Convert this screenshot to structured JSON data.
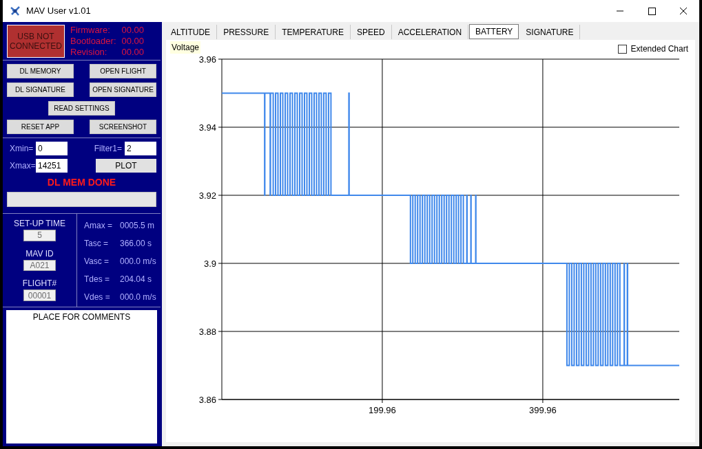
{
  "window": {
    "title": "MAV User v1.01"
  },
  "device": {
    "status": "USB NOT CONNECTED",
    "info": [
      {
        "label": "Firmware:",
        "value": "00.00"
      },
      {
        "label": "Bootloader:",
        "value": "00.00"
      },
      {
        "label": "Revision:",
        "value": "00.00"
      }
    ]
  },
  "button_rows": [
    [
      {
        "label": "DL MEMORY"
      },
      {
        "label": "OPEN FLIGHT"
      }
    ],
    [
      {
        "label": "DL SIGNATURE"
      },
      {
        "label": "OPEN SIGNATURE"
      }
    ],
    [
      {
        "label": "READ SETTINGS"
      }
    ],
    [
      {
        "label": "RESET APP"
      },
      {
        "label": "SCREENSHOT"
      }
    ]
  ],
  "plot_controls": {
    "xmin_label": "Xmin=",
    "xmin": "0",
    "filter_label": "Filter1=",
    "filter": "2",
    "xmax_label": "Xmax=",
    "xmax": "14251",
    "plot_button": "PLOT",
    "message": "DL MEM DONE",
    "progress": {
      "level": 0
    }
  },
  "setup": [
    {
      "label": "SET-UP TIME",
      "value": "5"
    },
    {
      "label": "MAV ID",
      "value": "A021"
    },
    {
      "label": "FLIGHT#",
      "value": "00001"
    }
  ],
  "results": [
    {
      "label": "Amax =",
      "value": "0005.5 m"
    },
    {
      "label": "Tasc =",
      "value": "366.00 s"
    },
    {
      "label": "Vasc =",
      "value": "000.0 m/s"
    },
    {
      "label": "Tdes =",
      "value": "204.04 s"
    },
    {
      "label": "Vdes =",
      "value": "000.0 m/s"
    }
  ],
  "comments": {
    "title": "PLACE FOR COMMENTS"
  },
  "tabs": [
    {
      "label": "ALTITUDE",
      "selected": false
    },
    {
      "label": "PRESSURE",
      "selected": false
    },
    {
      "label": "TEMPERATURE",
      "selected": false
    },
    {
      "label": "SPEED",
      "selected": false
    },
    {
      "label": "ACCELERATION",
      "selected": false
    },
    {
      "label": "BATTERY",
      "selected": true
    },
    {
      "label": "SIGNATURE",
      "selected": false
    }
  ],
  "extended_chart": {
    "label": "Extended Chart",
    "checked": false
  },
  "chart": {
    "chart_data": {
      "type": "line",
      "title": "Voltage",
      "grid": true,
      "xlim": [
        0,
        570
      ],
      "ylim": [
        3.86,
        3.96
      ],
      "xticks": [
        199.96,
        399.96
      ],
      "yticks": [
        3.86,
        3.88,
        3.9,
        3.92,
        3.94,
        3.96
      ],
      "x": [
        0,
        53,
        53.3,
        53.6,
        60,
        60.3,
        60.6,
        63,
        64,
        67,
        70,
        73,
        76,
        79,
        82,
        85,
        88,
        91,
        94,
        97,
        100,
        103,
        106,
        109,
        112,
        115,
        118,
        121,
        124,
        127,
        130,
        133,
        136,
        158,
        158.3,
        158.6,
        234,
        235,
        238,
        241,
        244,
        247,
        250,
        253,
        256,
        259,
        262,
        265,
        268,
        271,
        274,
        277,
        280,
        283,
        286,
        289,
        292,
        295,
        298,
        301,
        305,
        305.3,
        305.6,
        310,
        310.3,
        310.6,
        316,
        316.3,
        316.6,
        429,
        430,
        433,
        436,
        439,
        442,
        445,
        448,
        451,
        454,
        457,
        460,
        463,
        466,
        469,
        472,
        475,
        478,
        481,
        484,
        487,
        490,
        493,
        496,
        501,
        501.3,
        501.6,
        505,
        505.3,
        505.6,
        570
      ],
      "series": [
        {
          "color": "#3f88eb",
          "values": [
            3.95,
            3.95,
            3.92,
            3.95,
            3.95,
            3.92,
            3.95,
            3.95,
            3.92,
            3.95,
            3.92,
            3.95,
            3.92,
            3.95,
            3.92,
            3.95,
            3.92,
            3.95,
            3.92,
            3.95,
            3.92,
            3.95,
            3.92,
            3.95,
            3.92,
            3.95,
            3.92,
            3.95,
            3.92,
            3.95,
            3.92,
            3.95,
            3.92,
            3.92,
            3.95,
            3.92,
            3.92,
            3.9,
            3.92,
            3.9,
            3.92,
            3.9,
            3.92,
            3.9,
            3.92,
            3.9,
            3.92,
            3.9,
            3.92,
            3.9,
            3.92,
            3.9,
            3.92,
            3.9,
            3.92,
            3.9,
            3.92,
            3.9,
            3.92,
            3.9,
            3.9,
            3.92,
            3.9,
            3.9,
            3.92,
            3.9,
            3.9,
            3.92,
            3.9,
            3.9,
            3.87,
            3.9,
            3.87,
            3.9,
            3.87,
            3.9,
            3.87,
            3.9,
            3.87,
            3.9,
            3.87,
            3.9,
            3.87,
            3.9,
            3.87,
            3.9,
            3.87,
            3.9,
            3.87,
            3.9,
            3.87,
            3.9,
            3.87,
            3.87,
            3.9,
            3.87,
            3.87,
            3.9,
            3.87,
            3.87
          ]
        }
      ]
    }
  }
}
